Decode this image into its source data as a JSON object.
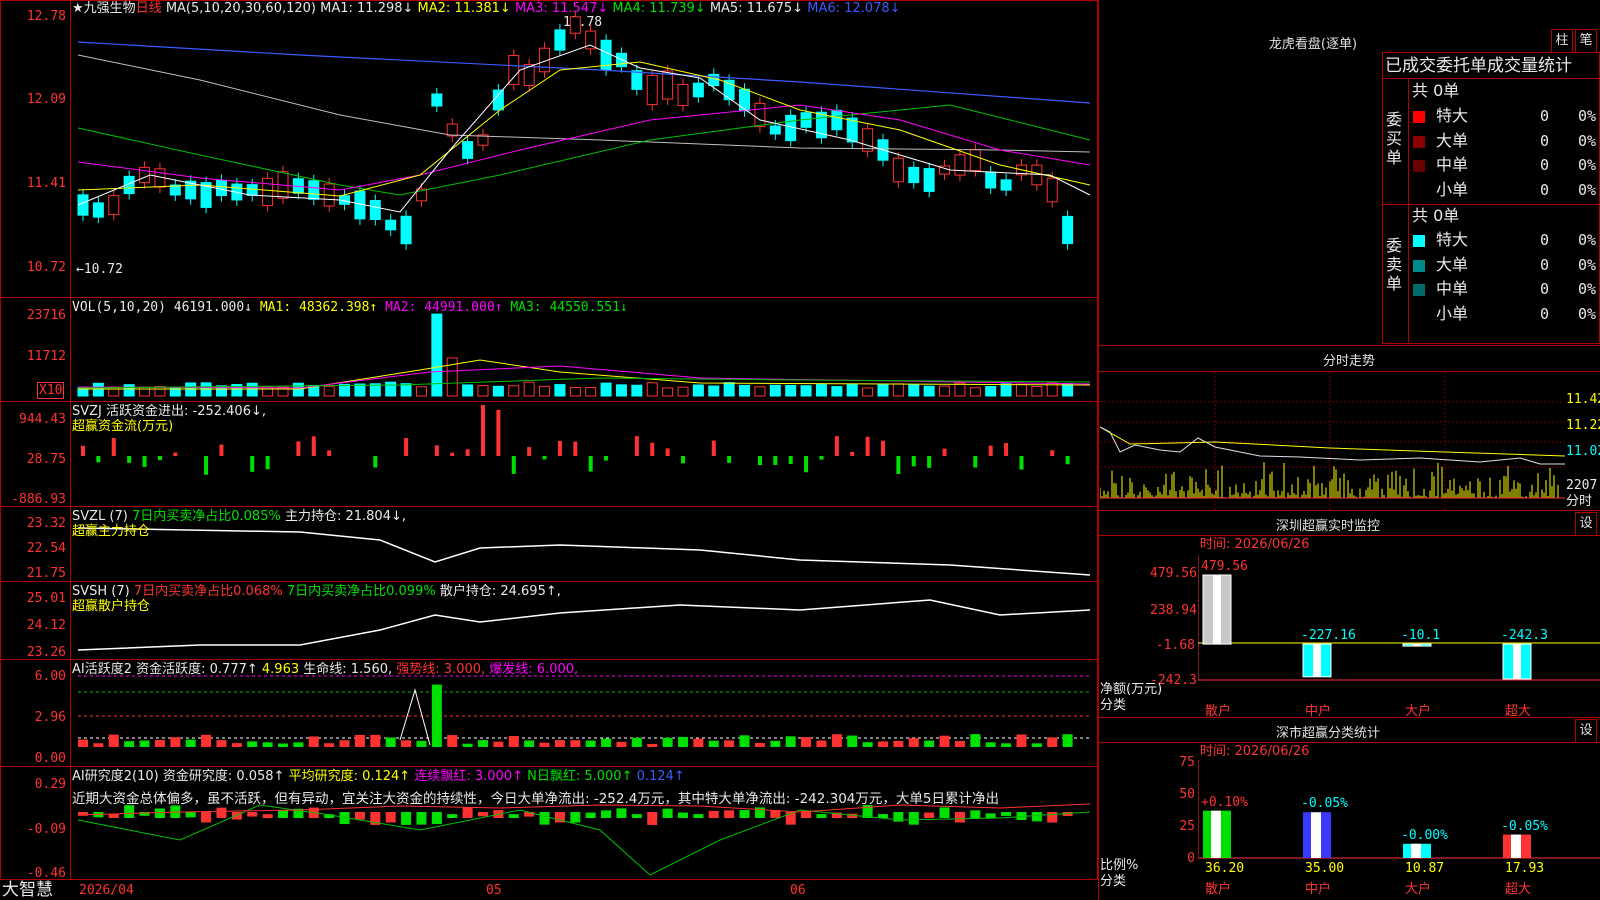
{
  "stock": {
    "name": "★九强生物",
    "period": "日线",
    "ma_label": "MA(5,10,20,30,60,120)",
    "ma_values": [
      "MA1: 11.298↓",
      "MA2: 11.381↓",
      "MA3: 11.547↓",
      "MA4: 11.739↓",
      "MA5: 11.675↓",
      "MA6: 12.078↓"
    ],
    "price_axis": [
      "12.78",
      "12.09",
      "11.41",
      "10.72"
    ],
    "high_mark": "12.78",
    "low_mark": "←10.72"
  },
  "vol": {
    "label": "VOL(5,10,20)",
    "value": "46191.000↓",
    "ma": [
      "MA1: 48362.398↑",
      "MA2: 44991.000↑",
      "MA3: 44550.551↓"
    ],
    "axis": [
      "23716",
      "11712"
    ],
    "x10": "X10"
  },
  "svzj": {
    "label": "SVZJ  活跃资金进出: -252.406↓,",
    "sub": "超赢资金流(万元)",
    "axis": [
      "944.43",
      "28.75",
      "-886.93"
    ]
  },
  "svzl": {
    "label": "SVZL (7)",
    "l2": "7日内买卖净占比0.085%",
    "l3": "主力持仓: 21.804↓,",
    "sub": "超赢主力持仓",
    "axis": [
      "23.32",
      "22.54",
      "21.75"
    ]
  },
  "svsh": {
    "label": "SVSH (7)",
    "l2": "7日内买卖净占比0.068%",
    "l3": "7日内买卖净占比0.099%",
    "l4": "散户持仓: 24.695↑,",
    "sub": "超赢散户持仓",
    "axis": [
      "25.01",
      "24.12",
      "23.26"
    ]
  },
  "ai1": {
    "label": "AI活跃度2 资金活跃度: 0.777↑",
    "l2": "4.963",
    "l3": "生命线: 1.560,",
    "l4": "强势线: 3.000,",
    "l5": "爆发线: 6.000,",
    "axis": [
      "6.00",
      "2.96",
      "0.00"
    ]
  },
  "ai2": {
    "label": "AI研究度2(10) 资金研究度: 0.058↑",
    "l2": "平均研究度: 0.124↑",
    "l3": "连续飘红: 3.000↑",
    "l4": "N日飘红: 5.000↑",
    "l5": "0.124↑",
    "comment": "近期大资金总体偏多，虽不活跃，但有异动，宜关注大资金的持续性，今日大单净流出: -252.4万元，其中特大单净流出: -242.304万元，大单5日累计净出",
    "axis": [
      "0.29",
      "-0.09",
      "-0.46"
    ]
  },
  "xaxis": {
    "d1": "2026/04",
    "d2": "05",
    "d3": "06",
    "brand": "大智慧"
  },
  "lhb": {
    "title": "龙虎看盘(逐单)",
    "btn1": "柱",
    "btn2": "笔",
    "header": "已成交委托单成交量统计",
    "buy": {
      "side": "委买单",
      "total": "共 0单",
      "rows": [
        {
          "label": "特大",
          "n": "0",
          "p": "0%"
        },
        {
          "label": "大单",
          "n": "0",
          "p": "0%"
        },
        {
          "label": "中单",
          "n": "0",
          "p": "0%"
        },
        {
          "label": "小单",
          "n": "0",
          "p": "0%"
        }
      ]
    },
    "sell": {
      "side": "委卖单",
      "total": "共 0单",
      "rows": [
        {
          "label": "特大",
          "n": "0",
          "p": "0%"
        },
        {
          "label": "大单",
          "n": "0",
          "p": "0%"
        },
        {
          "label": "中单",
          "n": "0",
          "p": "0%"
        },
        {
          "label": "小单",
          "n": "0",
          "p": "0%"
        }
      ]
    }
  },
  "intraday": {
    "title": "分时走势",
    "axis": [
      "11.42",
      "11.22",
      "11.02",
      "2207"
    ],
    "foot": "分时"
  },
  "monitor": {
    "title": "深圳超赢实时监控",
    "time": "时间: 2026/06/26",
    "btn": "设",
    "axis": [
      "479.56",
      "238.94",
      "-1.68",
      "-242.3"
    ],
    "ylabel": "净额(万元)",
    "xlabel": "分类",
    "bars": [
      {
        "cat": "散户",
        "value": "479.56"
      },
      {
        "cat": "中户",
        "value": "-227.16"
      },
      {
        "cat": "大户",
        "value": "-10.1"
      },
      {
        "cat": "超大",
        "value": "-242.3"
      }
    ]
  },
  "classify": {
    "title": "深市超赢分类统计",
    "time": "时间: 2026/06/26",
    "btn": "设",
    "axis": [
      "75",
      "50",
      "25",
      "0"
    ],
    "ylabel": "比例%",
    "xlabel": "分类",
    "bars": [
      {
        "cat": "散户",
        "pct": "+0.10%",
        "val": "36.20"
      },
      {
        "cat": "中户",
        "pct": "-0.05%",
        "val": "35.00"
      },
      {
        "cat": "大户",
        "pct": "-0.00%",
        "val": "10.87"
      },
      {
        "cat": "超大",
        "pct": "-0.05%",
        "val": "17.93"
      }
    ]
  }
}
